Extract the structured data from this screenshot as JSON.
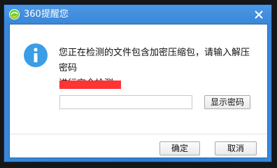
{
  "window": {
    "title": "360提醒您"
  },
  "message": {
    "text": "您正在检测的文件包含加密压缩包，请输入解压密码\n进行安全检测。"
  },
  "password": {
    "value": "",
    "placeholder": ""
  },
  "buttons": {
    "show_password_label": "显示密码",
    "ok_label": "确定",
    "cancel_label": "取消"
  },
  "colors": {
    "titlebar": "#3a86d8",
    "accent_red": "#ff3333",
    "info_icon": "#3b9de6"
  },
  "icons": {
    "logo": "360-logo-icon",
    "close": "close-icon",
    "info": "info-icon"
  }
}
